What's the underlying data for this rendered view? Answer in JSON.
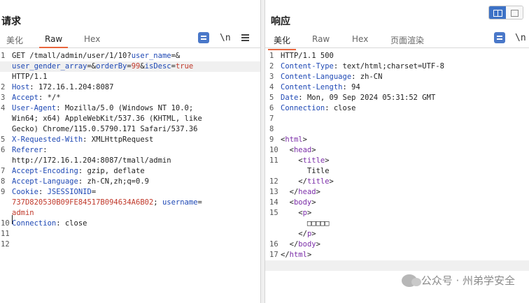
{
  "request": {
    "title": "请求",
    "tabs": [
      "美化",
      "Raw",
      "Hex"
    ],
    "active_tab": "Raw",
    "newline_tool": "\\n",
    "line_numbers": [
      "1",
      "2",
      "3",
      "4",
      "5",
      "6",
      "7",
      "8",
      "9",
      "10",
      "11",
      "12"
    ],
    "lines": [
      [
        {
          "t": "GET /tmall/admin/user/1/10?",
          "c": "plain"
        },
        {
          "t": "user_name",
          "c": "key"
        },
        {
          "t": "=&",
          "c": "plain"
        }
      ],
      [
        {
          "t": "user_gender_array",
          "c": "key"
        },
        {
          "t": "=&",
          "c": "plain"
        },
        {
          "t": "orderBy",
          "c": "key"
        },
        {
          "t": "=",
          "c": "plain"
        },
        {
          "t": "99",
          "c": "red"
        },
        {
          "t": "&",
          "c": "plain"
        },
        {
          "t": "isDesc",
          "c": "key"
        },
        {
          "t": "=",
          "c": "plain"
        },
        {
          "t": "true",
          "c": "red"
        }
      ],
      [
        {
          "t": "HTTP/1.1",
          "c": "plain"
        }
      ],
      [
        {
          "t": "Host",
          "c": "key"
        },
        {
          "t": ": 172.16.1.204:8087",
          "c": "plain"
        }
      ],
      [
        {
          "t": "Accept",
          "c": "key"
        },
        {
          "t": ": */*",
          "c": "plain"
        }
      ],
      [
        {
          "t": "User-Agent",
          "c": "key"
        },
        {
          "t": ": Mozilla/5.0 (Windows NT 10.0;",
          "c": "plain"
        }
      ],
      [
        {
          "t": "Win64; x64) AppleWebKit/537.36 (KHTML, like",
          "c": "plain"
        }
      ],
      [
        {
          "t": "Gecko) Chrome/115.0.5790.171 Safari/537.36",
          "c": "plain"
        }
      ],
      [
        {
          "t": "X-Requested-With",
          "c": "key"
        },
        {
          "t": ": XMLHttpRequest",
          "c": "plain"
        }
      ],
      [
        {
          "t": "Referer",
          "c": "key"
        },
        {
          "t": ":",
          "c": "plain"
        }
      ],
      [
        {
          "t": "http://172.16.1.204:8087/tmall/admin",
          "c": "plain"
        }
      ],
      [
        {
          "t": "Accept-Encoding",
          "c": "key"
        },
        {
          "t": ": gzip, deflate",
          "c": "plain"
        }
      ],
      [
        {
          "t": "Accept-Language",
          "c": "key"
        },
        {
          "t": ": zh-CN,zh;q=0.9",
          "c": "plain"
        }
      ],
      [
        {
          "t": "Cookie",
          "c": "key"
        },
        {
          "t": ": ",
          "c": "plain"
        },
        {
          "t": "JSESSIONID",
          "c": "key"
        },
        {
          "t": "=",
          "c": "plain"
        }
      ],
      [
        {
          "t": "737D820530B09FE84517B094634A6B02",
          "c": "red"
        },
        {
          "t": "; ",
          "c": "plain"
        },
        {
          "t": "username",
          "c": "key"
        },
        {
          "t": "=",
          "c": "plain"
        }
      ],
      [
        {
          "t": "admin",
          "c": "red"
        }
      ],
      [
        {
          "t": "Connection",
          "c": "key"
        },
        {
          "t": ": close",
          "c": "plain"
        }
      ],
      [],
      []
    ]
  },
  "response": {
    "title": "响应",
    "tabs": [
      "美化",
      "Raw",
      "Hex",
      "页面渲染"
    ],
    "active_tab": "美化",
    "newline_tool": "\\n",
    "line_numbers": [
      "1",
      "2",
      "3",
      "4",
      "5",
      "6",
      "7",
      "8",
      "9",
      "10",
      "11",
      "12",
      "13",
      "14",
      "15",
      "16",
      "17"
    ],
    "lines": [
      [
        {
          "t": "HTTP/1.1 500",
          "c": "plain"
        }
      ],
      [
        {
          "t": "Content-Type",
          "c": "key"
        },
        {
          "t": ": text/html;charset=UTF-8",
          "c": "plain"
        }
      ],
      [
        {
          "t": "Content-Language",
          "c": "key"
        },
        {
          "t": ": zh-CN",
          "c": "plain"
        }
      ],
      [
        {
          "t": "Content-Length",
          "c": "key"
        },
        {
          "t": ": 94",
          "c": "plain"
        }
      ],
      [
        {
          "t": "Date",
          "c": "key"
        },
        {
          "t": ": Mon, 09 Sep 2024 05:31:52 GMT",
          "c": "plain"
        }
      ],
      [
        {
          "t": "Connection",
          "c": "key"
        },
        {
          "t": ": close",
          "c": "plain"
        }
      ],
      [],
      [],
      [
        {
          "t": "<",
          "c": "plain"
        },
        {
          "t": "html",
          "c": "tag"
        },
        {
          "t": ">",
          "c": "plain"
        }
      ],
      [
        {
          "t": "  <",
          "c": "plain"
        },
        {
          "t": "head",
          "c": "tag"
        },
        {
          "t": ">",
          "c": "plain"
        }
      ],
      [
        {
          "t": "    <",
          "c": "plain"
        },
        {
          "t": "title",
          "c": "tag"
        },
        {
          "t": ">",
          "c": "plain"
        }
      ],
      [
        {
          "t": "      Title",
          "c": "plain"
        }
      ],
      [
        {
          "t": "    </",
          "c": "plain"
        },
        {
          "t": "title",
          "c": "tag"
        },
        {
          "t": ">",
          "c": "plain"
        }
      ],
      [
        {
          "t": "  </",
          "c": "plain"
        },
        {
          "t": "head",
          "c": "tag"
        },
        {
          "t": ">",
          "c": "plain"
        }
      ],
      [
        {
          "t": "  <",
          "c": "plain"
        },
        {
          "t": "body",
          "c": "tag"
        },
        {
          "t": ">",
          "c": "plain"
        }
      ],
      [
        {
          "t": "    <",
          "c": "plain"
        },
        {
          "t": "p",
          "c": "tag"
        },
        {
          "t": ">",
          "c": "plain"
        }
      ],
      [
        {
          "t": "      □□□□□",
          "c": "plain"
        }
      ],
      [
        {
          "t": "    </",
          "c": "plain"
        },
        {
          "t": "p",
          "c": "tag"
        },
        {
          "t": ">",
          "c": "plain"
        }
      ],
      [
        {
          "t": "  </",
          "c": "plain"
        },
        {
          "t": "body",
          "c": "tag"
        },
        {
          "t": ">",
          "c": "plain"
        }
      ],
      [
        {
          "t": "</",
          "c": "plain"
        },
        {
          "t": "html",
          "c": "tag"
        },
        {
          "t": ">",
          "c": "plain"
        }
      ],
      []
    ]
  },
  "watermark": {
    "text": "公众号 · 州弟学安全"
  },
  "colors": {
    "accent": "#e8663d",
    "key": "#1f49b5",
    "value": "#c0392b",
    "tag": "#7b2ea8",
    "toggle_active": "#3d72c6"
  }
}
